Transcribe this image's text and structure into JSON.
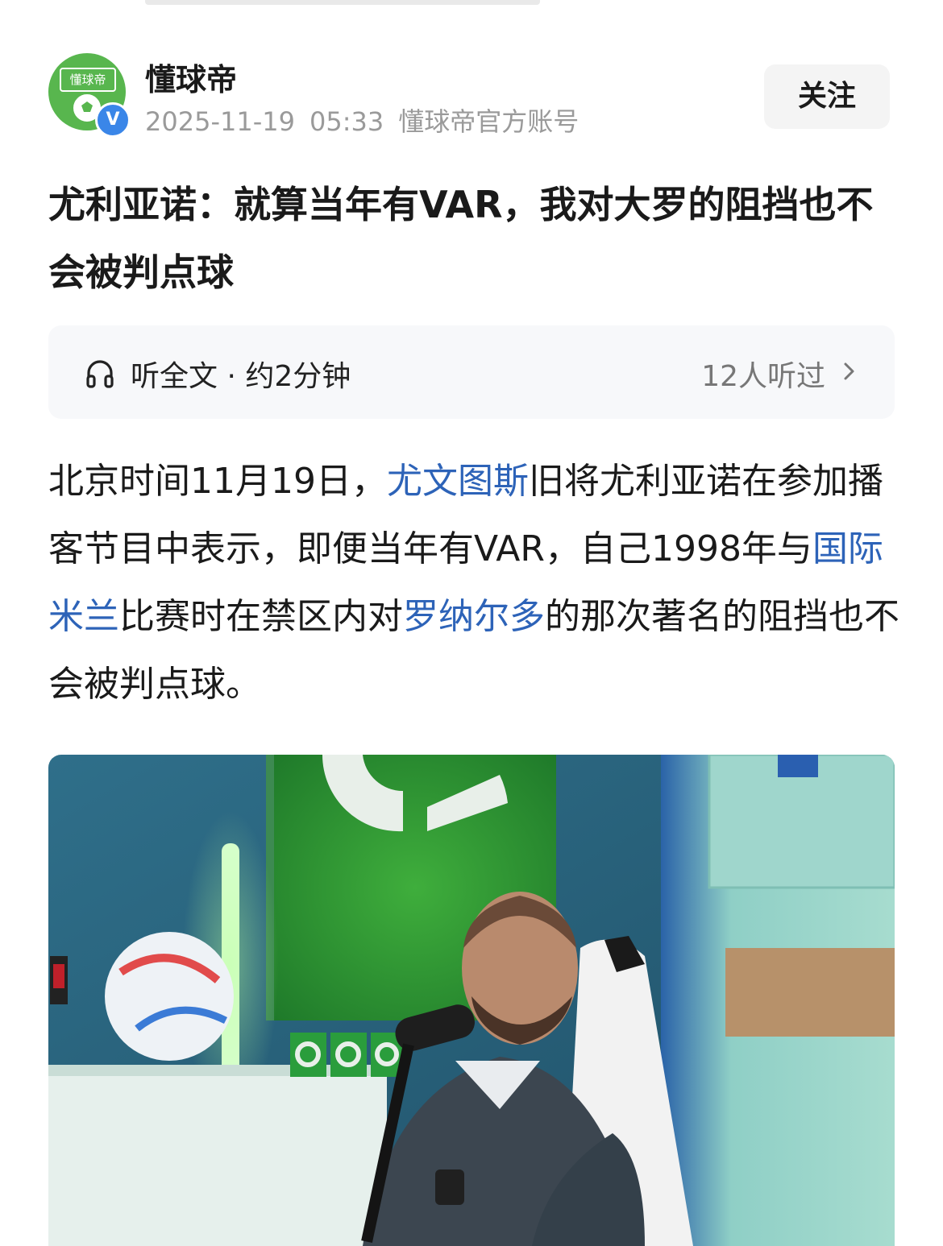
{
  "author": {
    "avatar_text": "懂球帝",
    "verified_mark": "V",
    "name": "懂球帝",
    "date": "2025-11-19",
    "time": "05:33",
    "account_type": "懂球帝官方账号",
    "follow_label": "关注"
  },
  "article": {
    "title": "尤利亚诺：就算当年有VAR，我对大罗的阻挡也不会被判点球",
    "listen": {
      "label": "听全文 · 约2分钟",
      "count": "12人听过",
      "icon": "headphone-icon"
    },
    "body": {
      "t1": "北京时间11月19日，",
      "link1": "尤文图斯",
      "t2": "旧将尤利亚诺在参加播客节目中表示，即便当年有VAR，自己1998年与",
      "link2": "国际米兰",
      "t3": "比赛时在禁区内对",
      "link3": "罗纳尔多",
      "t4": "的那次著名的阻挡也不会被判点球。"
    }
  },
  "colors": {
    "brand_green": "#58b64e",
    "link_blue": "#2d63b8",
    "verified_blue": "#3a86e8"
  }
}
